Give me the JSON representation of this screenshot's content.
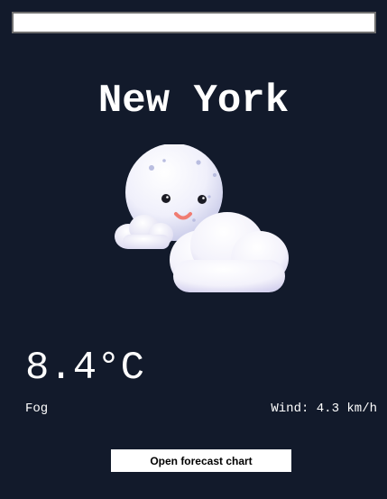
{
  "search": {
    "value": "",
    "placeholder": ""
  },
  "weather": {
    "city": "New York",
    "temperature": "8.4°C",
    "condition": "Fog",
    "wind": "Wind: 4.3 km/h",
    "icon": "moon-with-clouds-icon"
  },
  "actions": {
    "forecast_label": "Open forecast chart"
  }
}
